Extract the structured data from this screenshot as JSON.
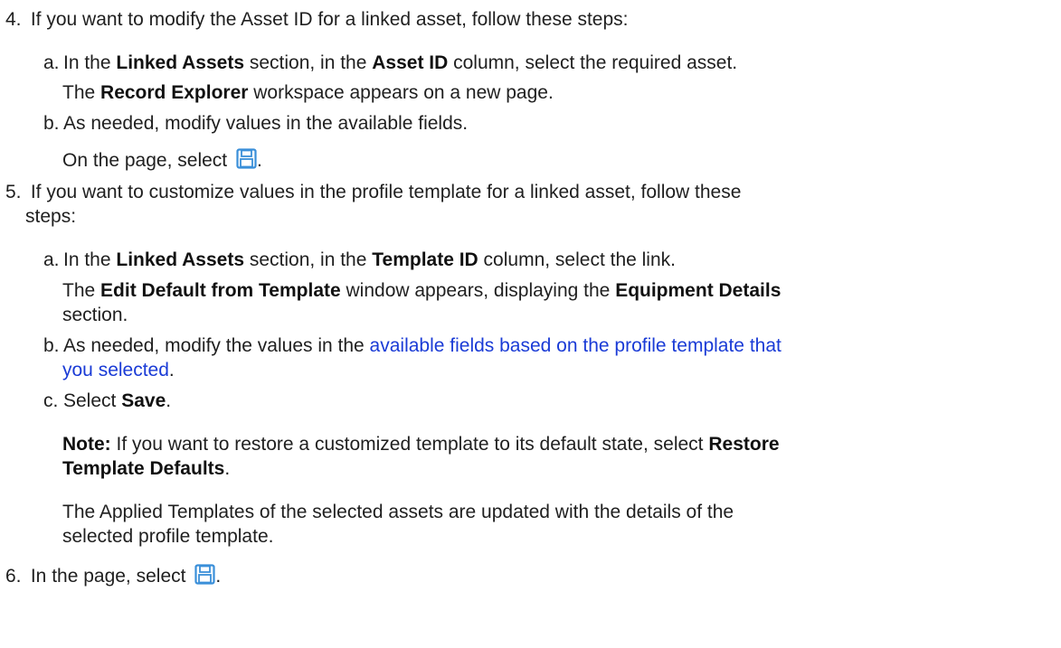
{
  "steps": {
    "s4": {
      "number": "4.",
      "text": "If you want to modify the Asset ID for a linked asset, follow these steps:",
      "a": {
        "letter": "a.",
        "t1": "In the ",
        "b1": "Linked Assets",
        "t2": " section, in the ",
        "b2": "Asset ID",
        "t3": " column, select the required asset.",
        "r1": "The ",
        "rb": "Record Explorer",
        "r2": " workspace appears on a new page."
      },
      "b": {
        "letter": "b.",
        "text": "As needed, modify values in the available fields.",
        "select_prefix": "On the page, select ",
        "select_suffix": "."
      }
    },
    "s5": {
      "number": "5.",
      "line1": "If you want to customize values in the profile template for a linked asset, follow these",
      "line2": "steps:",
      "a": {
        "letter": "a.",
        "t1": "In the ",
        "b1": "Linked Assets",
        "t2": " section, in the ",
        "b2": "Template ID",
        "t3": " column, select the link.",
        "r1": "The ",
        "rb1": "Edit Default from Template",
        "r2": " window appears, displaying the ",
        "rb2": "Equipment Details",
        "r3": "section."
      },
      "b": {
        "letter": "b.",
        "prefix": "As needed, modify the values in the ",
        "link1": "available fields based on the profile template that",
        "link2": "you selected",
        "suffix": "."
      },
      "c": {
        "letter": "c.",
        "prefix": "Select ",
        "bold": "Save",
        "suffix": "."
      },
      "note": {
        "label": "Note:",
        "text": " If you want to restore a customized template to its default state, select ",
        "bold1": "Restore",
        "bold2": "Template Defaults",
        "suffix": "."
      },
      "result": {
        "line1": "The Applied Templates of the selected assets are updated with the details of the",
        "line2": "selected profile template."
      }
    },
    "s6": {
      "number": "6.",
      "prefix": "In the page, select ",
      "suffix": "."
    }
  },
  "icons": {
    "save": "save-icon",
    "accent": "#3a8fd9"
  },
  "colors": {
    "text": "#1f1f1f",
    "link": "#1a3bd6"
  }
}
